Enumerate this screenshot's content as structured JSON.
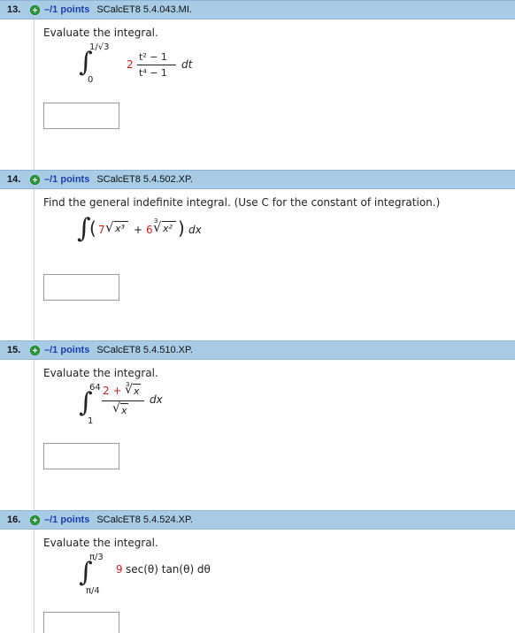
{
  "questions": [
    {
      "number": "13.",
      "points": "–/1 points",
      "source": "SCalcET8 5.4.043.MI.",
      "prompt": "Evaluate the integral.",
      "upper_limit": "1/√3",
      "lower_limit": "0",
      "coefficient": "2",
      "numerator": "t² − 1",
      "denominator": "t⁴ − 1",
      "differential": "dt"
    },
    {
      "number": "14.",
      "points": "–/1 points",
      "source": "SCalcET8 5.4.502.XP.",
      "prompt": "Find the general indefinite integral. (Use C for the constant of integration.)",
      "term1_coef": "7",
      "term1_radicand": "x³",
      "plus": "+",
      "term2_coef": "6",
      "term2_index": "3",
      "term2_radicand": "x²",
      "differential": "dx"
    },
    {
      "number": "15.",
      "points": "–/1 points",
      "source": "SCalcET8 5.4.510.XP.",
      "prompt": "Evaluate the integral.",
      "upper_limit": "64",
      "lower_limit": "1",
      "numerator_const": "2 +",
      "numerator_index": "3",
      "numerator_radicand": "x",
      "denominator_radicand": "x",
      "differential": "dx"
    },
    {
      "number": "16.",
      "points": "–/1 points",
      "source": "SCalcET8 5.4.524.XP.",
      "prompt": "Evaluate the integral.",
      "upper_limit": "π/3",
      "lower_limit": "π/4",
      "coefficient": "9",
      "integrand": "sec(θ) tan(θ) dθ"
    }
  ],
  "colors": {
    "header_bg": "#a8cbe6",
    "points_text": "#1a3fb0",
    "math_highlight": "#cc1f1f",
    "plus_icon": "#2e9b3a"
  }
}
